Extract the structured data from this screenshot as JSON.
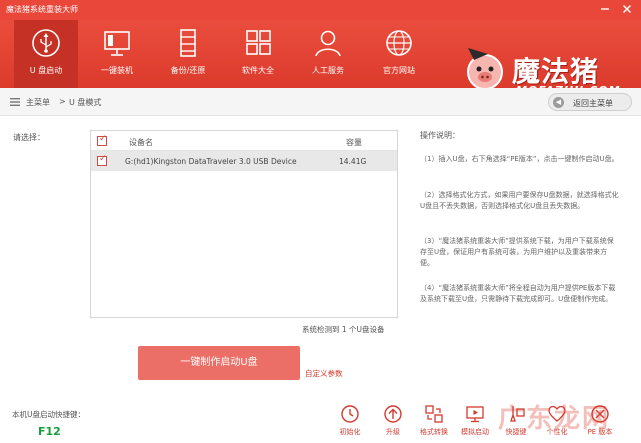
{
  "window": {
    "title": "魔法猪系统重装大师",
    "minimize_icon": "minimize-icon",
    "close_icon": "close-icon"
  },
  "nav": [
    {
      "label": "U 盘启动",
      "icon": "usb-icon",
      "active": true
    },
    {
      "label": "一键装机",
      "icon": "monitor-icon",
      "active": false
    },
    {
      "label": "备份/还原",
      "icon": "backup-icon",
      "active": false
    },
    {
      "label": "软件大全",
      "icon": "apps-icon",
      "active": false
    },
    {
      "label": "人工服务",
      "icon": "user-icon",
      "active": false
    },
    {
      "label": "官方网站",
      "icon": "globe-icon",
      "active": false
    }
  ],
  "logo": {
    "main": "魔法猪",
    "sub": "MOFAZHU.COM",
    "icon": "pig-logo-icon"
  },
  "breadcrumb": {
    "home": "主菜单",
    "separator": ">",
    "current": "U 盘模式",
    "back_label": "返回主菜单"
  },
  "device_select": {
    "label": "请选择：",
    "columns": [
      "设备名",
      "容量"
    ],
    "rows": [
      {
        "checked": true,
        "name": "G:(hd1)Kingston DataTraveler 3.0 USB Device",
        "capacity": "14.41G"
      }
    ],
    "summary": "系统检测到 1 个U盘设备"
  },
  "instructions": {
    "title": "操作说明：",
    "steps": [
      "（1）插入U盘，右下角选择“PE版本”，点击一键制作启动U盘。",
      "（2）选择格式化方式，如果用户要保存U盘数据，就选择格式化U盘且不丢失数据，否则选择格式化U盘且丢失数据。",
      "（3）“魔法猪系统重装大师”提供系统下载，为用户下载系统保存至U盘，保证用户有系统可装，为用户维护以及重装带来方便。",
      "（4）“魔法猪系统重装大师”将全程自动为用户提供PE版本下载及系统下载至U盘，只需静待下载完成即可。U盘便制作完成。"
    ]
  },
  "actions": {
    "make_button": "一键制作启动U盘",
    "custom_link": "自定义参数"
  },
  "shortcut": {
    "label": "本机U盘启动快捷键：",
    "key": "F12"
  },
  "tools": [
    {
      "label": "初始化",
      "icon": "reset-icon"
    },
    {
      "label": "升级",
      "icon": "upgrade-icon"
    },
    {
      "label": "格式转换",
      "icon": "convert-icon"
    },
    {
      "label": "模拟启动",
      "icon": "simulate-icon"
    },
    {
      "label": "快捷键",
      "icon": "shortcut-key-icon"
    },
    {
      "label": "个性化",
      "icon": "personalize-icon"
    },
    {
      "label": "PE 版本",
      "icon": "pe-version-icon"
    }
  ],
  "watermark": {
    "text": "广东龙网"
  },
  "colors": {
    "brand_red": "#e9473a",
    "active_tab": "#c63126",
    "make_button": "#eb6f66",
    "link_red": "#d43a2e",
    "shortcut_green": "#1a9e3a"
  }
}
